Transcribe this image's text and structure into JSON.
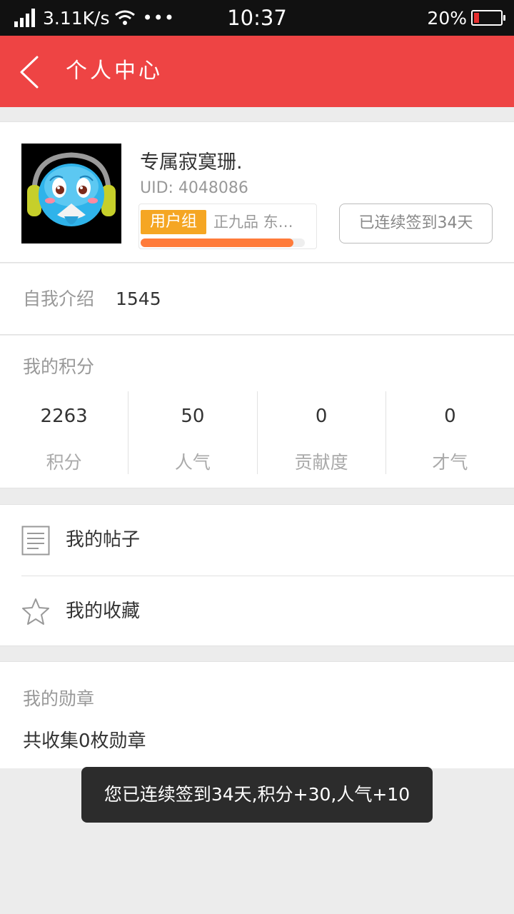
{
  "status_bar": {
    "speed": "3.11K/s",
    "dots": "•••",
    "time": "10:37",
    "battery": "20%",
    "battery_level": 0.2
  },
  "header": {
    "title": "个人中心"
  },
  "profile": {
    "username": "专属寂寞珊.",
    "uid": "UID: 4048086",
    "group_tag": "用户组",
    "group_names": "正九品  东…",
    "progress": 0.93,
    "checkin_label": "已连续签到34天"
  },
  "intro": {
    "label": "自我介绍",
    "value": "1545"
  },
  "points": {
    "title": "我的积分",
    "items": [
      {
        "value": "2263",
        "label": "积分"
      },
      {
        "value": "50",
        "label": "人气"
      },
      {
        "value": "0",
        "label": "贡献度"
      },
      {
        "value": "0",
        "label": "才气"
      }
    ]
  },
  "menu": {
    "posts": "我的帖子",
    "favorites": "我的收藏"
  },
  "medals": {
    "title": "我的勋章",
    "summary": "共收集0枚勋章"
  },
  "toast": {
    "message": "您已连续签到34天,积分+30,人气+10"
  },
  "colors": {
    "header": "#ee4444",
    "group_tag": "#f5a623",
    "progress": "#ff7b3a"
  }
}
